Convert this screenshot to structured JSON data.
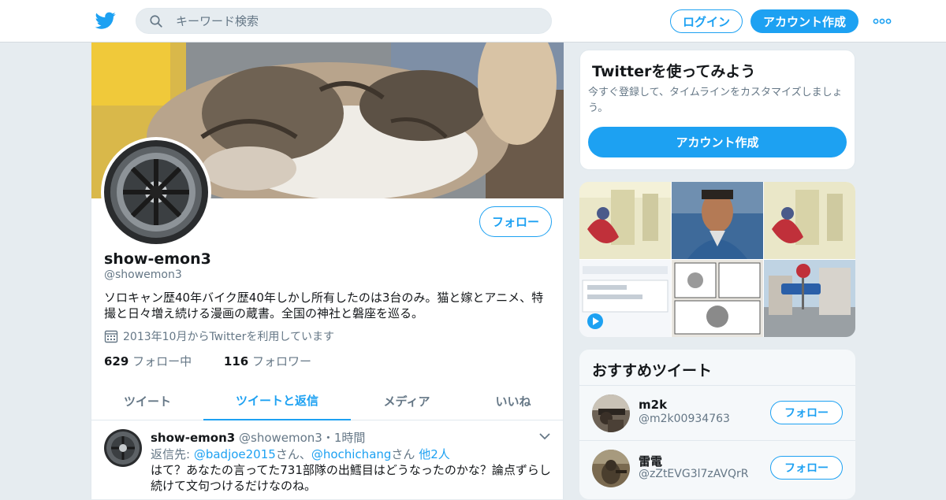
{
  "topbar": {
    "search_placeholder": "キーワード検索",
    "login_label": "ログイン",
    "signup_label": "アカウント作成"
  },
  "profile": {
    "name": "show-emon3",
    "handle": "@showemon3",
    "follow_label": "フォロー",
    "bio": "ソロキャン歴40年バイク歴40年しかし所有したのは3台のみ。猫と嫁とアニメ、特撮と日々増え続ける漫画の蔵書。全国の神社と磐座を巡る。",
    "joined": "2013年10月からTwitterを利用しています",
    "following_count": "629",
    "following_label": "フォロー中",
    "followers_count": "116",
    "followers_label": "フォロワー"
  },
  "tabs": [
    {
      "label": "ツイート"
    },
    {
      "label": "ツイートと返信",
      "active": true
    },
    {
      "label": "メディア"
    },
    {
      "label": "いいね"
    }
  ],
  "tweet": {
    "name": "show-emon3",
    "handle": "@showemon3",
    "sep": "・",
    "time": "1時間",
    "reply_prefix": "返信先: ",
    "reply_user1": "@badjoe2015",
    "reply_san1": "さん、",
    "reply_user2": "@hochichang",
    "reply_san2": "さん ",
    "reply_others": "他2人",
    "text": "はて？あなたの言ってた731部隊の出鱈目はどうなったのかな？論点ずらし続けて文句つけるだけなのね。"
  },
  "sidebar": {
    "try_title": "Twitterを使ってみよう",
    "try_text": "今すぐ登録して、タイムラインをカスタマイズしましょう。",
    "try_button": "アカウント作成",
    "rec_title": "おすすめツイート",
    "rec_users": [
      {
        "name": "m2k",
        "handle": "@m2k00934763",
        "follow_label": "フォロー"
      },
      {
        "name": "雷電",
        "handle": "@zZtEVG3l7zAVQrR",
        "follow_label": "フォロー"
      }
    ]
  },
  "colors": {
    "accent": "#1da1f2",
    "muted": "#657786",
    "bg": "#e6ecf0"
  }
}
